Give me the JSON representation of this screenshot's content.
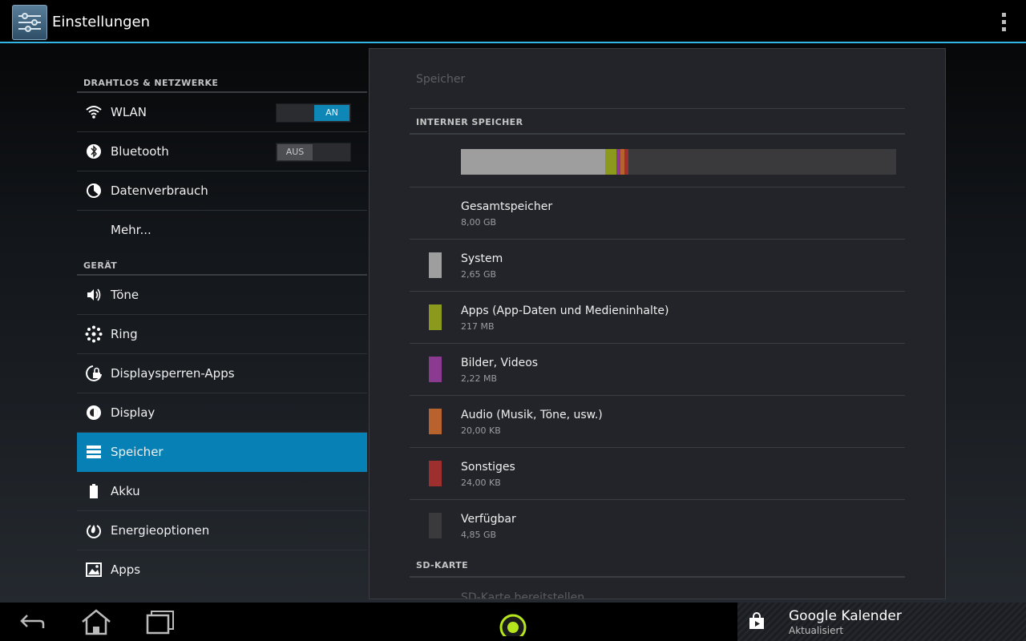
{
  "actionbar": {
    "title": "Einstellungen",
    "app_icon": "settings-sliders-icon",
    "overflow_icon": "overflow-menu-icon"
  },
  "left": {
    "sections": [
      {
        "header": "DRAHTLOS & NETZWERKE",
        "items": [
          {
            "label": "WLAN",
            "icon": "wifi-icon",
            "toggle": {
              "text": "AN",
              "state": "on"
            }
          },
          {
            "label": "Bluetooth",
            "icon": "bluetooth-icon",
            "toggle": {
              "text": "AUS",
              "state": "off"
            }
          },
          {
            "label": "Datenverbrauch",
            "icon": "data-usage-icon"
          },
          {
            "label": "Mehr..."
          }
        ]
      },
      {
        "header": "GERÄT",
        "items": [
          {
            "label": "Töne",
            "icon": "sound-icon"
          },
          {
            "label": "Ring",
            "icon": "ring-icon"
          },
          {
            "label": "Displaysperren-Apps",
            "icon": "lock-apps-icon"
          },
          {
            "label": "Display",
            "icon": "display-icon"
          },
          {
            "label": "Speicher",
            "icon": "storage-icon",
            "selected": true
          },
          {
            "label": "Akku",
            "icon": "battery-icon"
          },
          {
            "label": "Energieoptionen",
            "icon": "power-icon"
          },
          {
            "label": "Apps",
            "icon": "apps-icon"
          }
        ]
      }
    ]
  },
  "right": {
    "title": "Speicher",
    "internal_header": "INTERNER SPEICHER",
    "usage_bar_fractions": [
      {
        "label": "System",
        "fraction": 0.331,
        "color": "#9e9e9e"
      },
      {
        "label": "Apps",
        "fraction": 0.026,
        "color": "#8b9a1c"
      },
      {
        "label": "Bilder",
        "fraction": 0.009,
        "color": "#8a3b8f"
      },
      {
        "label": "Audio",
        "fraction": 0.009,
        "color": "#b8632e"
      },
      {
        "label": "Sonstiges",
        "fraction": 0.009,
        "color": "#9e2f2f"
      }
    ],
    "rows": [
      {
        "name": "Gesamtspeicher",
        "size": "8,00 GB"
      },
      {
        "name": "System",
        "size": "2,65 GB",
        "color": "#9e9e9e"
      },
      {
        "name": "Apps (App-Daten und Medieninhalte)",
        "size": "217 MB",
        "color": "#8b9a1c"
      },
      {
        "name": "Bilder, Videos",
        "size": "2,22 MB",
        "color": "#8a3b8f"
      },
      {
        "name": "Audio (Musik, Töne, usw.)",
        "size": "20,00 KB",
        "color": "#b8632e"
      },
      {
        "name": "Sonstiges",
        "size": "24,00 KB",
        "color": "#9e2f2f"
      },
      {
        "name": "Verfügbar",
        "size": "4,85 GB",
        "color": "#3a3a3d"
      }
    ],
    "sd_header": "SD-KARTE",
    "sd_first_item": "SD-Karte bereitstellen"
  },
  "navbar": {
    "back_icon": "back-icon",
    "home_icon": "home-icon",
    "recents_icon": "recent-apps-icon",
    "ring_icon": "ring-launcher-icon",
    "notification": {
      "icon": "play-store-icon",
      "title": "Google Kalender",
      "subtitle": "Aktualisiert"
    }
  }
}
